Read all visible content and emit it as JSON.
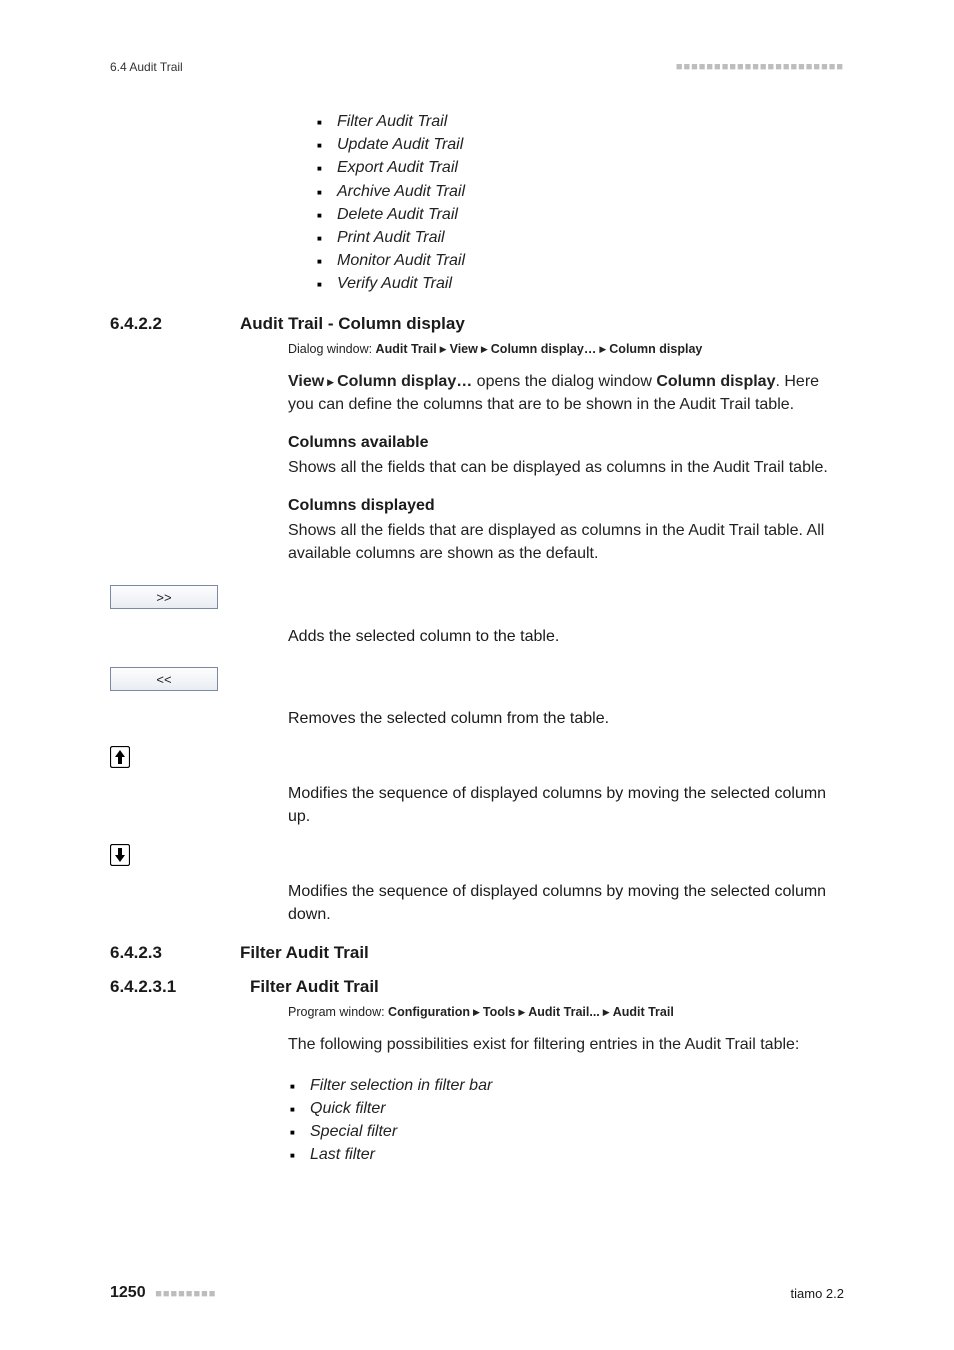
{
  "header": {
    "section_tag": "6.4 Audit Trail",
    "dashes": "■■■■■■■■■■■■■■■■■■■■■■"
  },
  "top_bullets": [
    "Filter Audit Trail",
    "Update Audit Trail",
    "Export Audit Trail",
    "Archive Audit Trail",
    "Delete Audit Trail",
    "Print Audit Trail",
    "Monitor Audit Trail",
    "Verify Audit Trail"
  ],
  "s1": {
    "num": "6.4.2.2",
    "title": "Audit Trail - Column display",
    "dialog_prefix": "Dialog window: ",
    "dialog_parts": [
      "Audit Trail",
      "View",
      "Column display…",
      "Column display"
    ],
    "intro_lead": "View",
    "intro_mid": "Column display…",
    "intro_mid2": " opens the dialog window ",
    "intro_bold2": "Column display",
    "intro_tail": ". Here you can define the columns that are to be shown in the Audit Trail table.",
    "ca_head": "Columns available",
    "ca_body": "Shows all the fields that can be displayed as columns in the Audit Trail table.",
    "cd_head": "Columns displayed",
    "cd_body": "Shows all the fields that are displayed as columns in the Audit Trail table. All available columns are shown as the default.",
    "btn_add": ">>",
    "btn_add_desc": "Adds the selected column to the table.",
    "btn_rm": "<<",
    "btn_rm_desc": "Removes the selected column from the table.",
    "btn_up_desc": "Modifies the sequence of displayed columns by moving the selected column up.",
    "btn_dn_desc": "Modifies the sequence of displayed columns by moving the selected column down."
  },
  "s2": {
    "num": "6.4.2.3",
    "title": "Filter Audit Trail"
  },
  "s3": {
    "num": "6.4.2.3.1",
    "title": "Filter Audit Trail",
    "prog_prefix": "Program window: ",
    "prog_parts": [
      "Configuration",
      "Tools",
      "Audit Trail...",
      "Audit Trail"
    ],
    "intro": "The following possibilities exist for filtering entries in the Audit Trail table:",
    "bullets": [
      "Filter selection in filter bar",
      "Quick filter",
      "Special filter",
      "Last filter"
    ]
  },
  "footer": {
    "page": "1250",
    "dashes": "■■■■■■■■",
    "product": "tiamo 2.2"
  }
}
